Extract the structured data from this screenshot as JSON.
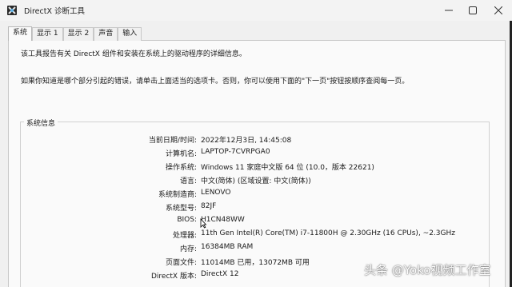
{
  "window": {
    "title": "DirectX 诊断工具",
    "minimize_icon": "minimize-icon",
    "maximize_icon": "maximize-icon",
    "close_icon": "close-icon"
  },
  "tabs": [
    {
      "label": "系统",
      "active": true
    },
    {
      "label": "显示 1",
      "active": false
    },
    {
      "label": "显示 2",
      "active": false
    },
    {
      "label": "声音",
      "active": false
    },
    {
      "label": "输入",
      "active": false
    }
  ],
  "description": {
    "line1": "该工具报告有关 DirectX 组件和安装在系统上的驱动程序的详细信息。",
    "line2": "如果你知道是哪个部分引起的错误，请单击上面适当的选项卡。否则，你可以使用下面的\"下一页\"按钮按顺序查阅每一页。"
  },
  "system_info": {
    "group_title": "系统信息",
    "rows": [
      {
        "label": "当前日期/时间:",
        "value": "2022年12月3日, 14:45:08"
      },
      {
        "label": "计算机名:",
        "value": "LAPTOP-7CVRPGA0"
      },
      {
        "label": "操作系统:",
        "value": "Windows 11 家庭中文版 64 位 (10.0，版本 22621)"
      },
      {
        "label": "语言:",
        "value": "中文(简体) (区域设置: 中文(简体))"
      },
      {
        "label": "系统制造商:",
        "value": "LENOVO"
      },
      {
        "label": "系统型号:",
        "value": "82JF"
      },
      {
        "label": "BIOS:",
        "value": "H1CN48WW"
      },
      {
        "label": "处理器:",
        "value": "11th Gen Intel(R) Core(TM) i7-11800H @ 2.30GHz (16 CPUs), ~2.3GHz"
      },
      {
        "label": "内存:",
        "value": "16384MB RAM"
      },
      {
        "label": "页面文件:",
        "value": "11014MB 已用，13072MB 可用"
      },
      {
        "label": "DirectX 版本:",
        "value": "DirectX 12"
      }
    ]
  },
  "watermark": {
    "text": "头条 @Yoko视频工作室"
  }
}
